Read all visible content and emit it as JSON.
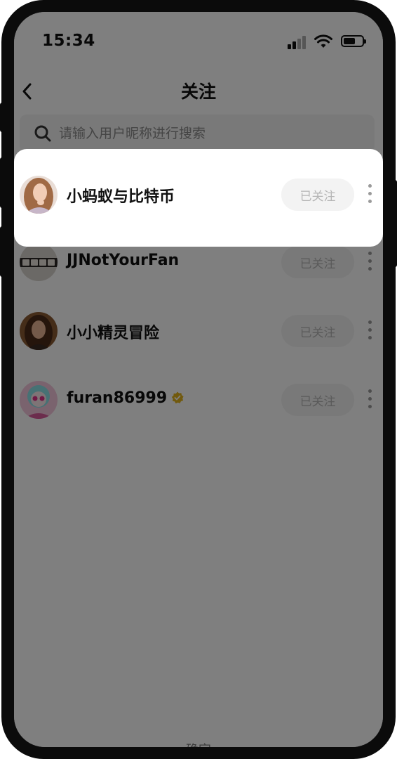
{
  "status_bar": {
    "time": "15:34",
    "icons": [
      "signal-icon",
      "wifi-icon",
      "battery-icon"
    ]
  },
  "nav": {
    "title": "关注",
    "back_icon": "chevron-left-icon"
  },
  "search": {
    "placeholder": "请输入用户昵称进行搜索",
    "value": ""
  },
  "following": [
    {
      "name": "小蚂蚁与比特币",
      "button": "已关注",
      "verified": false,
      "highlighted": true
    },
    {
      "name": "JJNotYourFan",
      "button": "已关注",
      "verified": false,
      "highlighted": false
    },
    {
      "name": "小小精灵冒险",
      "button": "已关注",
      "verified": false,
      "highlighted": false
    },
    {
      "name": "furan86999",
      "button": "已关注",
      "verified": true,
      "highlighted": false
    }
  ],
  "bottom_hint": "确定",
  "colors": {
    "overlay": "#000000",
    "follow_button_bg": "#f3f3f3",
    "verified_badge": "#e2b21a"
  }
}
